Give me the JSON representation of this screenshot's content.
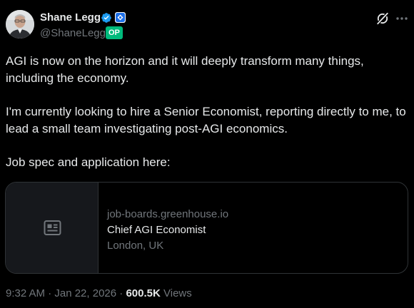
{
  "author": {
    "name": "Shane Legg",
    "handle": "@ShaneLegg",
    "badge": "OP",
    "verified_color": "#1d9bf0",
    "badge_color": "#00ba7c"
  },
  "tweet": {
    "paragraphs": [
      "AGI is now on the horizon and it will deeply transform many things, including the economy.",
      "I'm currently looking to hire a Senior Economist, reporting directly to me, to lead a small team investigating post-AGI economics.",
      "Job spec and application here:"
    ]
  },
  "card": {
    "domain": "job-boards.greenhouse.io",
    "title": "Chief AGI Economist",
    "description": "London, UK",
    "thumbnail_icon": "article-icon"
  },
  "meta": {
    "timestamp": "9:32 AM · Jan 22, 2026",
    "separator": " · ",
    "views_count": "600.5K",
    "views_label": "Views"
  },
  "icons": {
    "grok": "grok-icon",
    "more": "more-icon"
  }
}
